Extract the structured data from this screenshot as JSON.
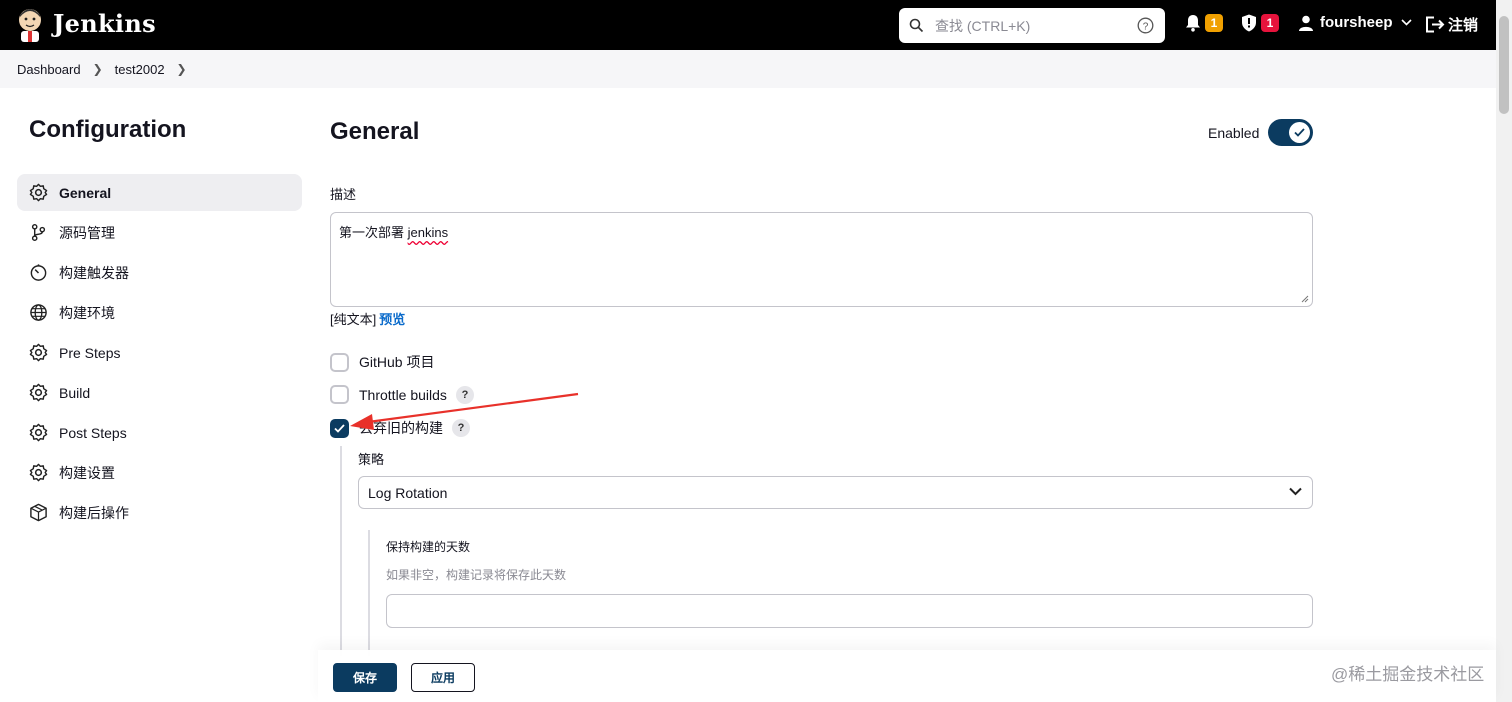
{
  "header": {
    "brand": "Jenkins",
    "search_placeholder": "查找 (CTRL+K)",
    "notifications_count": "1",
    "security_count": "1",
    "user_name": "foursheep",
    "logout_label": "注销"
  },
  "breadcrumb": [
    "Dashboard",
    "test2002"
  ],
  "sidebar": {
    "title": "Configuration",
    "items": [
      {
        "label": "General",
        "icon": "gear-icon",
        "active": true
      },
      {
        "label": "源码管理",
        "icon": "branch-icon"
      },
      {
        "label": "构建触发器",
        "icon": "timer-icon"
      },
      {
        "label": "构建环境",
        "icon": "globe-icon"
      },
      {
        "label": "Pre Steps",
        "icon": "gear-icon"
      },
      {
        "label": "Build",
        "icon": "gear-icon"
      },
      {
        "label": "Post Steps",
        "icon": "gear-icon"
      },
      {
        "label": "构建设置",
        "icon": "gear-icon"
      },
      {
        "label": "构建后操作",
        "icon": "cube-icon"
      }
    ]
  },
  "main": {
    "title": "General",
    "enabled_label": "Enabled",
    "enabled": true,
    "description_label": "描述",
    "description_prefix": "第一次部署 ",
    "description_word": "jenkins",
    "format_plain": "[纯文本]",
    "format_preview": "预览",
    "options": [
      {
        "label": "GitHub 项目",
        "checked": false,
        "help": false
      },
      {
        "label": "Throttle builds",
        "checked": false,
        "help": true
      },
      {
        "label": "丢弃旧的构建",
        "checked": true,
        "help": true
      }
    ],
    "help_glyph": "?",
    "strategy_label": "策略",
    "strategy_value": "Log Rotation",
    "days_label": "保持构建的天数",
    "days_hint": "如果非空，构建记录将保存此天数",
    "days_value": ""
  },
  "footer": {
    "save_label": "保存",
    "apply_label": "应用",
    "watermark": "@稀土掘金技术社区"
  },
  "colors": {
    "header_bg": "#000000",
    "primary": "#0b3b60",
    "link": "#0b6bcb",
    "badge_orange": "#f0a000",
    "badge_red": "#e6133c",
    "annotation_arrow": "#e8312a"
  }
}
